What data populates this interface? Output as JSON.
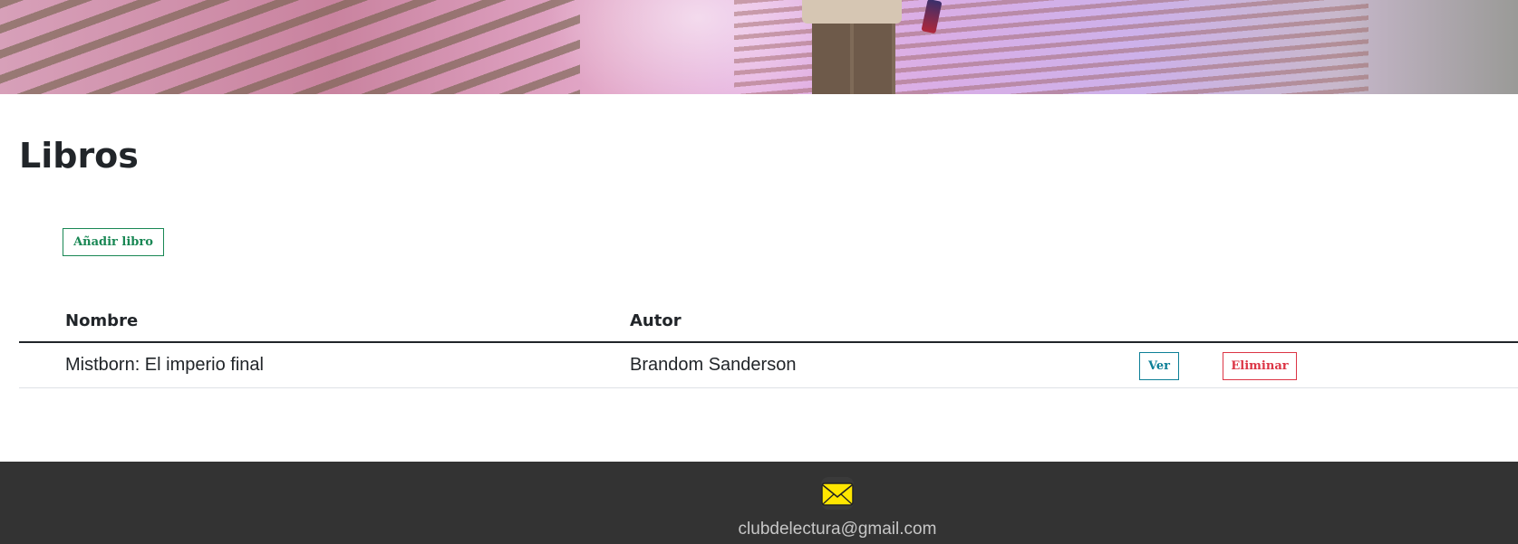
{
  "page": {
    "title": "Libros"
  },
  "actions": {
    "add_label": "Añadir libro"
  },
  "table": {
    "headers": [
      "Nombre",
      "Autor"
    ],
    "rows": [
      {
        "nombre": "Mistborn: El imperio final",
        "autor": "Brandom Sanderson",
        "view_label": "Ver",
        "delete_label": "Eliminar"
      }
    ]
  },
  "footer": {
    "email": "clubdelectura@gmail.com",
    "icon": "envelope-icon"
  },
  "colors": {
    "add": "#198754",
    "view": "#0d7f97",
    "delete": "#dc3545",
    "footer_bg": "#333333",
    "envelope": "#ffe600"
  }
}
